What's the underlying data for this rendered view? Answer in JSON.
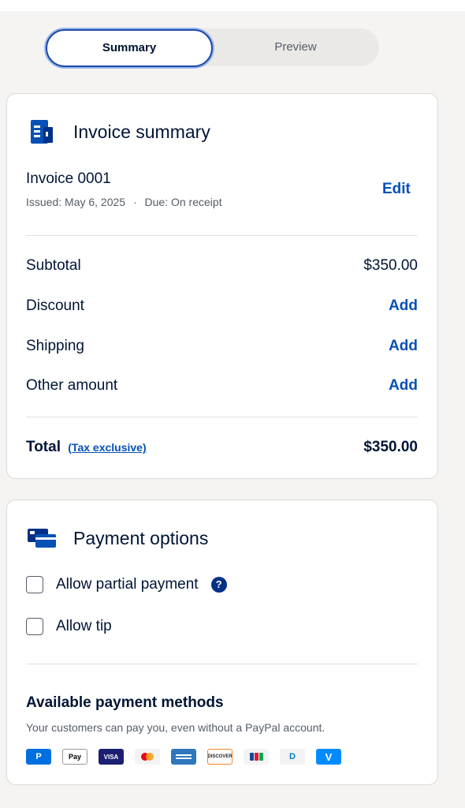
{
  "tabs": {
    "summary": "Summary",
    "preview": "Preview"
  },
  "invoice_card": {
    "title": "Invoice summary",
    "invoice_name": "Invoice 0001",
    "issued": "Issued: May 6, 2025",
    "separator": "·",
    "due": "Due: On receipt",
    "edit_label": "Edit",
    "rows": [
      {
        "label": "Subtotal",
        "value": "$350.00"
      },
      {
        "label": "Discount",
        "action": "Add"
      },
      {
        "label": "Shipping",
        "action": "Add"
      },
      {
        "label": "Other amount",
        "action": "Add"
      }
    ],
    "total_label": "Total",
    "tax_label": "(Tax exclusive)",
    "total_value": "$350.00"
  },
  "payment_card": {
    "title": "Payment options",
    "options": [
      {
        "label": "Allow partial payment",
        "checked": false,
        "help": "?"
      },
      {
        "label": "Allow tip",
        "checked": false
      }
    ],
    "methods_title": "Available payment methods",
    "methods_subtitle": "Your customers can pay you, even without a PayPal account.",
    "methods": [
      {
        "icon": "paypal-icon",
        "text": "P"
      },
      {
        "icon": "apple-pay-icon",
        "text": "Pay"
      },
      {
        "icon": "visa-icon",
        "text": "VISA"
      },
      {
        "icon": "mastercard-icon",
        "text": ""
      },
      {
        "icon": "amex-icon",
        "text": ""
      },
      {
        "icon": "discover-icon",
        "text": "DISCOVER"
      },
      {
        "icon": "jcb-icon",
        "text": ""
      },
      {
        "icon": "diners-icon",
        "text": "D"
      },
      {
        "icon": "venmo-icon",
        "text": "V"
      }
    ]
  },
  "colors": {
    "link": "#0551b5",
    "text": "#001435",
    "muted": "#545d68",
    "accent_border": "#1f4aa8",
    "help_icon": "#003087"
  }
}
